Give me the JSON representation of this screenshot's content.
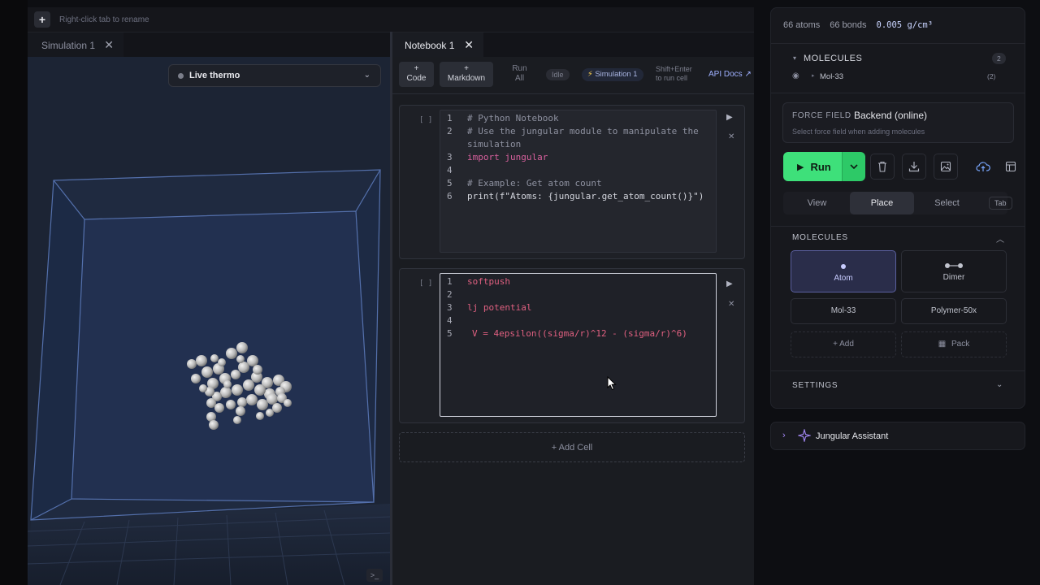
{
  "topbar": {
    "hint": "Right-click tab to rename"
  },
  "tabs": [
    {
      "label": "Simulation 1"
    },
    {
      "label": "Notebook 1"
    }
  ],
  "viewport": {
    "thermo_label": "Live thermo",
    "terminal_glyph": ">_"
  },
  "notebook": {
    "toolbar": {
      "add_code": "+ Code",
      "add_markdown": "+ Markdown",
      "run_all": "Run All",
      "status": "Idle",
      "simulation_chip": "Simulation 1",
      "shortcut_hint_1": "Shift+Enter",
      "shortcut_hint_2": "to run cell",
      "api_docs": "API Docs ↗"
    },
    "cells": [
      {
        "bracket": "[ ]",
        "lines": [
          {
            "n": "1",
            "text": "# Python Notebook"
          },
          {
            "n": "2",
            "text": "# Use the jungular module to manipulate the"
          },
          {
            "n": "",
            "text": "simulation"
          },
          {
            "n": "3",
            "text": "import jungular"
          },
          {
            "n": "4",
            "text": ""
          },
          {
            "n": "5",
            "text": "# Example: Get atom count"
          },
          {
            "n": "6",
            "text": "print(f\"Atoms: {jungular.get_atom_count()}\")"
          }
        ]
      },
      {
        "bracket": "[ ]",
        "lines": [
          {
            "n": "1",
            "text": "softpush"
          },
          {
            "n": "2",
            "text": ""
          },
          {
            "n": "3",
            "text": "lj potential"
          },
          {
            "n": "4",
            "text": ""
          },
          {
            "n": "5",
            "text": "V = 4epsilon((sigma/r)^12 - (sigma/r)^6)"
          }
        ]
      }
    ],
    "add_cell": "+ Add Cell"
  },
  "panel": {
    "stats": {
      "atoms": "66 atoms",
      "bonds": "66 bonds",
      "density": "0.005 g/cm³"
    },
    "molecules_header": "MOLECULES",
    "molecules_count": "2",
    "molecule_item": {
      "name": "Mol-33",
      "count": "(2)"
    },
    "force_field": {
      "label": "FORCE FIELD",
      "value": "Backend (online)",
      "hint": "Select force field when adding molecules"
    },
    "run_label": "Run",
    "modes": [
      "View",
      "Place",
      "Select"
    ],
    "mode_key": "Tab",
    "molecules_section": "MOLECULES",
    "molecule_cards": [
      {
        "label": "Atom"
      },
      {
        "label": "Dimer"
      },
      {
        "label": "Mol-33"
      },
      {
        "label": "Polymer-50x"
      },
      {
        "label": "+  Add"
      },
      {
        "label": "Pack"
      }
    ],
    "settings": "SETTINGS"
  },
  "assistant": {
    "label": "Jungular Assistant"
  },
  "colors": {
    "accent_green": "#3ee07a",
    "accent_purple": "#a78bfa",
    "selected_card": "#2a2d4a"
  }
}
